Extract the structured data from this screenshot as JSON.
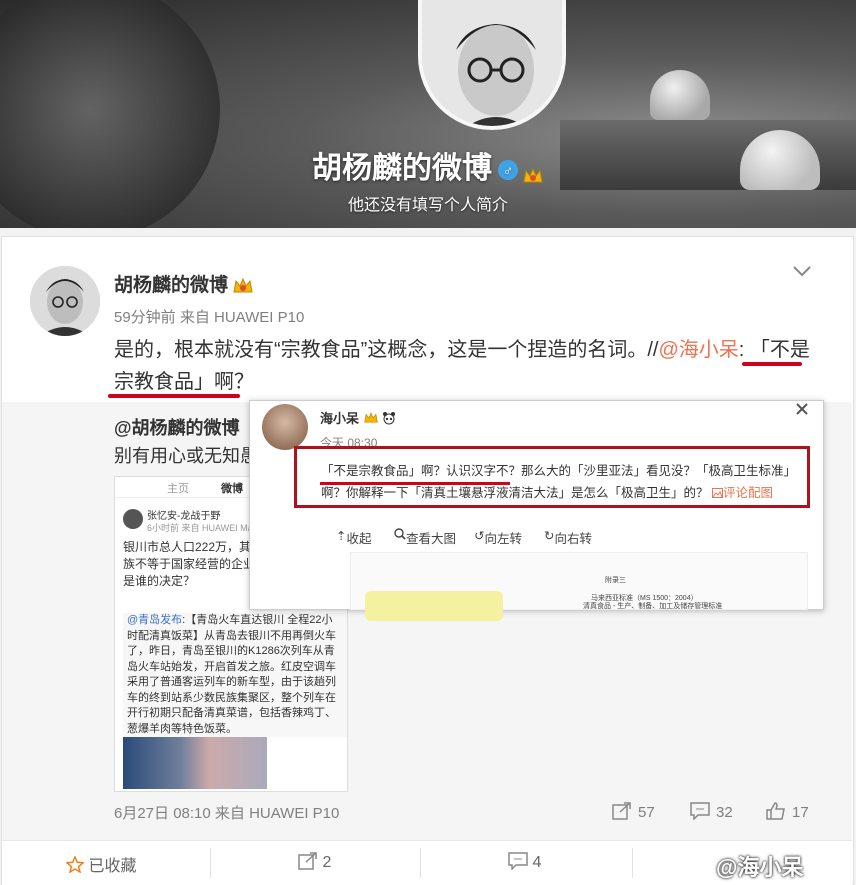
{
  "banner": {
    "name": "胡杨麟的微博",
    "bio": "他还没有填写个人简介",
    "gender_badge": "♂"
  },
  "post": {
    "author": "胡杨麟的微博",
    "meta": "59分钟前 来自 HUAWEI P10",
    "text_before": "是的，根本就没有“宗教食品”这概念，这是一个捏造的名词。//",
    "mention": "@海小呆",
    "text_after": ": 「不是宗教食品」啊？"
  },
  "repost": {
    "author": "@胡杨麟的微博",
    "text": "别有用心或无知愚",
    "thumb": {
      "tab_home": "主页",
      "tab_weibo": "微博",
      "user": "张忆安-龙战于野",
      "time": "6小时前  来自 HUAWEI Ma",
      "body": "银川市总人口222万，其回族57万。且回族不等于国家经营的企业，只对屉品，这是谁的决定？",
      "quote_mention": "@青岛发布",
      "quote_text": ":【青岛火车直达银川 全程22小时配清真饭菜】从青岛去银川不用再倒火车了，昨日，青岛至银川的K1286次列车从青岛火车站始发，开启首发之旅。红皮空调车采用了普通客运列车的新车型，由于该趟列车的终到站系少数民族集聚区，整个列车在开行初期只配备清真菜谱，包括香辣鸡丁、葱爆羊肉等特色饭菜。"
    },
    "date": "6月27日 08:10 来自 HUAWEI P10",
    "forwards": "57",
    "comments": "32",
    "likes": "17"
  },
  "popup": {
    "name": "海小呆",
    "time": "今天 08:30",
    "text": "「不是宗教食品」啊？认识汉字不？那么大的「沙里亚法」看见没？「极高卫生标准」啊？你解释一下「清真土壤悬浮液清洁大法」是怎么「极高卫生」的？",
    "comment_link": "评论配图",
    "tools": {
      "collapse": "收起",
      "view_large": "查看大图",
      "rotate_left": "向左转",
      "rotate_right": "向右转"
    },
    "doc_heading": "附录三",
    "doc_subheading": "马来西亚标准（MS 1500：2004）",
    "doc_line": "清真食品 - 生产、制备、加工及储存管理标准"
  },
  "actions": {
    "favorite": "已收藏",
    "forward": "2",
    "comment": "4"
  },
  "watermark": "@海小呆",
  "colors": {
    "mention": "#eb7350",
    "highlight_red": "#d0021b",
    "link_blue": "#3b73c8"
  }
}
